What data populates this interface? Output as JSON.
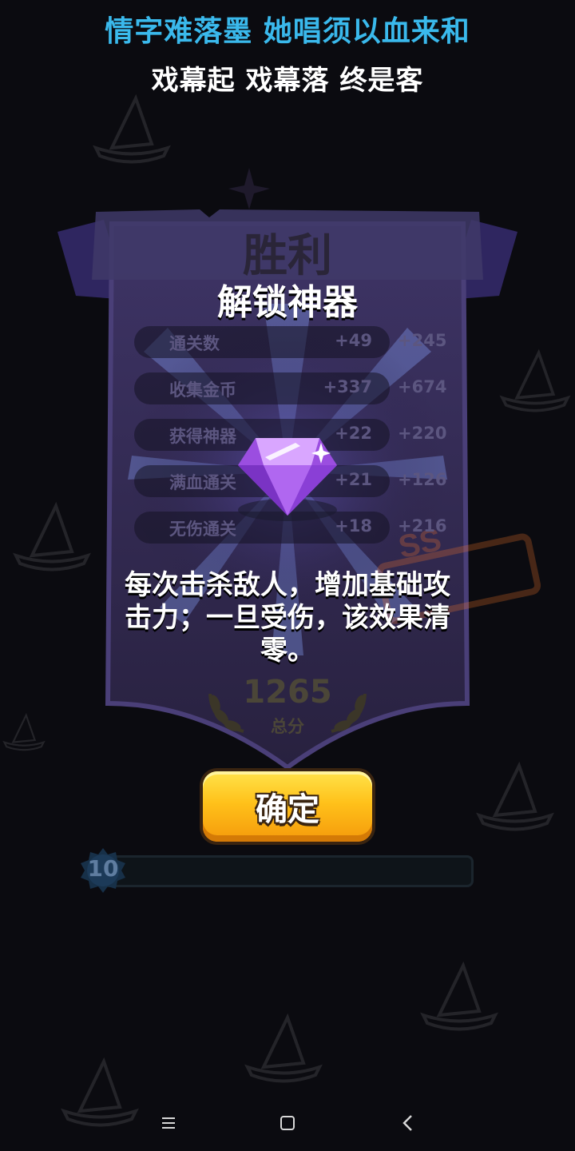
{
  "lyrics": {
    "line1": "情字难落墨 她唱须以血来和",
    "line2": "戏幕起 戏幕落 终是客"
  },
  "panel": {
    "title": "胜利",
    "subtitle": "解锁神器",
    "rows": [
      {
        "label": "通关数",
        "value": "+49",
        "bonus": "+245"
      },
      {
        "label": "收集金币",
        "value": "+337",
        "bonus": "+674"
      },
      {
        "label": "获得神器",
        "value": "+22",
        "bonus": "+220"
      },
      {
        "label": "满血通关",
        "value": "+21",
        "bonus": "+126"
      },
      {
        "label": "无伤通关",
        "value": "+18",
        "bonus": "+216"
      }
    ],
    "artifact_icon": "purple-gem-icon",
    "description": "每次击杀敌人，增加基础攻击力；一旦受伤，该效果清零。",
    "score": "1265",
    "score_label": "总分"
  },
  "confirm_button": {
    "label": "确定"
  },
  "level": {
    "number": "10",
    "progress": 0.0
  },
  "nav": {
    "icons": [
      "menu-icon",
      "home-square-icon",
      "back-icon"
    ]
  },
  "colors": {
    "lyric_primary": "#3ab9ec",
    "button_gold": "#ffc11a",
    "gem_purple": "#a454e8",
    "panel_purple": "#3a3060"
  }
}
